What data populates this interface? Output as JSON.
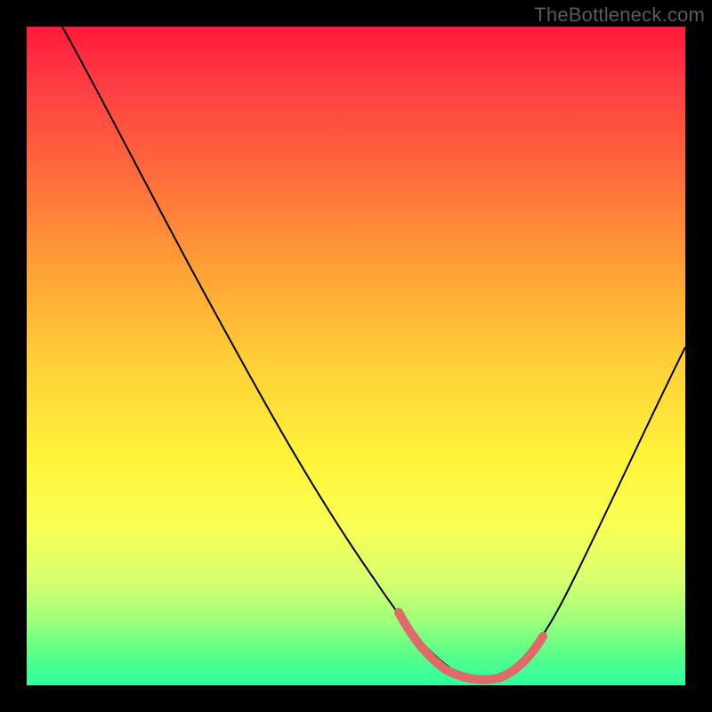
{
  "watermark": "TheBottleneck.com",
  "colors": {
    "gradient_top": "#ff1a3a",
    "gradient_mid": "#fff43a",
    "gradient_bottom": "#2cffa0",
    "curve": "#000000",
    "highlight": "#e06a6a",
    "background": "#000000"
  },
  "chart_data": {
    "type": "line",
    "title": "",
    "xlabel": "",
    "ylabel": "",
    "xlim": [
      0,
      100
    ],
    "ylim": [
      0,
      100
    ],
    "grid": false,
    "series": [
      {
        "name": "bottleneck-curve",
        "x": [
          0,
          6,
          12,
          18,
          24,
          30,
          36,
          42,
          48,
          54,
          58,
          62,
          66,
          70,
          74,
          78,
          82,
          86,
          90,
          94,
          100
        ],
        "y": [
          100,
          94,
          86,
          78,
          69,
          60,
          51,
          42,
          33,
          22,
          14,
          7,
          3,
          1,
          0,
          1,
          4,
          11,
          22,
          35,
          55
        ]
      }
    ],
    "annotations": [
      {
        "name": "optimal-zone-highlight",
        "x": [
          56,
          60,
          64,
          68,
          72,
          76,
          80
        ],
        "y": [
          18,
          10,
          4,
          1,
          0,
          1,
          6
        ]
      }
    ]
  }
}
